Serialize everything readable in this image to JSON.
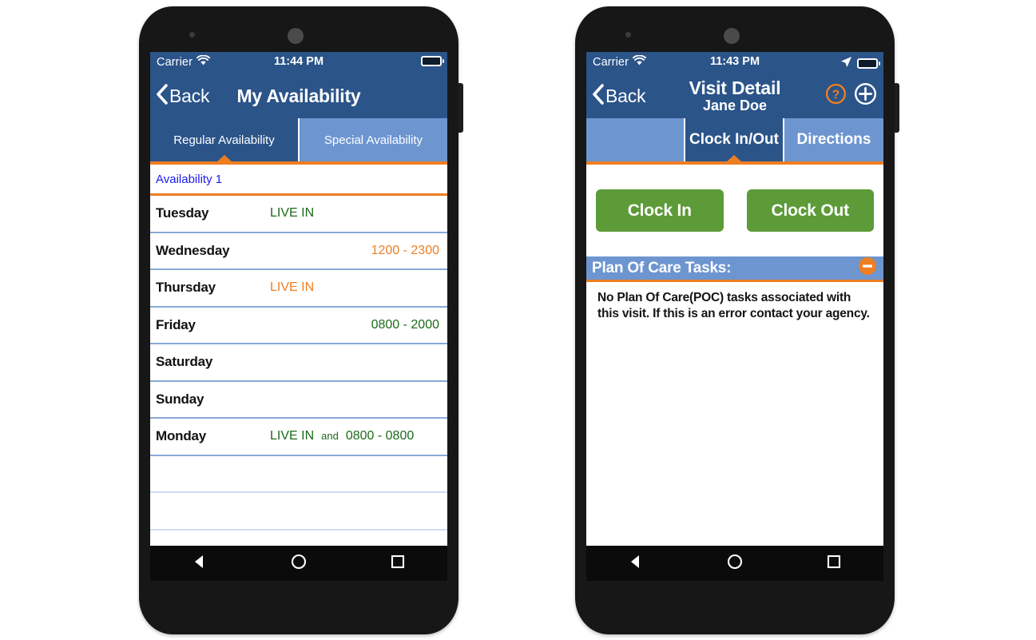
{
  "colors": {
    "header_blue": "#2b5489",
    "tab_inactive_blue": "#6d95d0",
    "accent_orange": "#ee7e22",
    "green_button": "#5c9b37",
    "link_blue": "#1a1aee",
    "value_green": "#1a6a1a",
    "value_orange": "#ee7e22"
  },
  "phone_left": {
    "status_bar": {
      "carrier": "Carrier",
      "wifi_icon": "wifi-icon",
      "time": "11:44 PM",
      "battery_icon": "battery-icon"
    },
    "nav": {
      "back_label": "Back",
      "back_icon": "chevron-left-icon",
      "title": "My Availability"
    },
    "tabs": [
      {
        "label": "Regular Availability",
        "active": true
      },
      {
        "label": "Special Availability",
        "active": false
      }
    ],
    "list_header": "Availability 1",
    "rows": [
      {
        "day": "Tuesday",
        "align": "center",
        "parts": [
          {
            "text": "LIVE IN",
            "color": "#1a6a1a"
          }
        ]
      },
      {
        "day": "Wednesday",
        "align": "right",
        "parts": [
          {
            "text": "1200 - 2300",
            "color": "#ee7e22"
          }
        ]
      },
      {
        "day": "Thursday",
        "align": "center",
        "parts": [
          {
            "text": "LIVE IN",
            "color": "#ee7e22"
          }
        ]
      },
      {
        "day": "Friday",
        "align": "right",
        "parts": [
          {
            "text": "0800 - 2000",
            "color": "#1a6a1a"
          }
        ]
      },
      {
        "day": "Saturday",
        "align": "center",
        "parts": []
      },
      {
        "day": "Sunday",
        "align": "center",
        "parts": []
      },
      {
        "day": "Monday",
        "align": "split",
        "parts": [
          {
            "text": "LIVE IN",
            "color": "#1a6a1a"
          },
          {
            "text": "and",
            "color": "#1a6a1a",
            "small": true
          },
          {
            "text": "0800 - 0800",
            "color": "#1a6a1a"
          }
        ]
      }
    ],
    "empty_rows": 2,
    "android_nav": [
      "back-triangle-icon",
      "home-circle-icon",
      "recents-square-icon"
    ]
  },
  "phone_right": {
    "status_bar": {
      "carrier": "Carrier",
      "wifi_icon": "wifi-icon",
      "time": "11:43 PM",
      "location_icon": "location-arrow-icon",
      "battery_icon": "battery-icon"
    },
    "nav": {
      "back_label": "Back",
      "back_icon": "chevron-left-icon",
      "title": "Visit Detail",
      "subtitle": "Jane Doe",
      "help_icon": "help-circle-icon",
      "add_icon": "plus-circle-icon"
    },
    "tabs": [
      {
        "label": "",
        "active": false,
        "spacer": true
      },
      {
        "label": "Clock In/Out",
        "active": true
      },
      {
        "label": "Directions",
        "active": false
      }
    ],
    "clock_in_label": "Clock In",
    "clock_out_label": "Clock Out",
    "poc": {
      "title": "Plan Of Care Tasks:",
      "collapse_icon": "minus-circle-icon",
      "message": "No Plan Of Care(POC) tasks associated with this visit. If this is an error contact your agency."
    },
    "android_nav": [
      "back-triangle-icon",
      "home-circle-icon",
      "recents-square-icon"
    ]
  }
}
